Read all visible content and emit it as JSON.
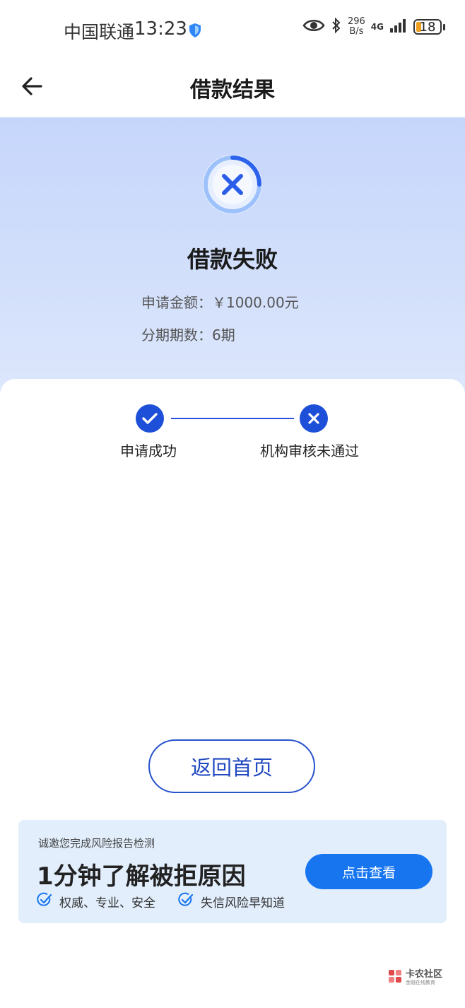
{
  "status_bar": {
    "carrier": "中国联通",
    "time": "13:23",
    "net_speed_value": "296",
    "net_speed_unit": "B/s",
    "network_type": "4G",
    "battery": "18"
  },
  "nav": {
    "title": "借款结果"
  },
  "result": {
    "title": "借款失败",
    "amount_line": "申请金额：￥1000.00元",
    "installments_line": "分期期数：6期"
  },
  "steps": [
    {
      "label": "申请成功",
      "status": "success"
    },
    {
      "label": "机构审核未通过",
      "status": "failed"
    }
  ],
  "home_button": "返回首页",
  "promo": {
    "subtitle": "诚邀您完成风险报告检测",
    "headline": "1分钟了解被拒原因",
    "tags": [
      "权威、专业、安全",
      "失信风险早知道"
    ],
    "button": "点击查看"
  },
  "watermark": {
    "name": "卡农社区",
    "tagline": "金融在线教育"
  },
  "colors": {
    "accent": "#1775f0",
    "step_blue": "#1d4fd8",
    "hero_bg": "#c6d6fb",
    "promo_bg": "#e2eefc"
  }
}
